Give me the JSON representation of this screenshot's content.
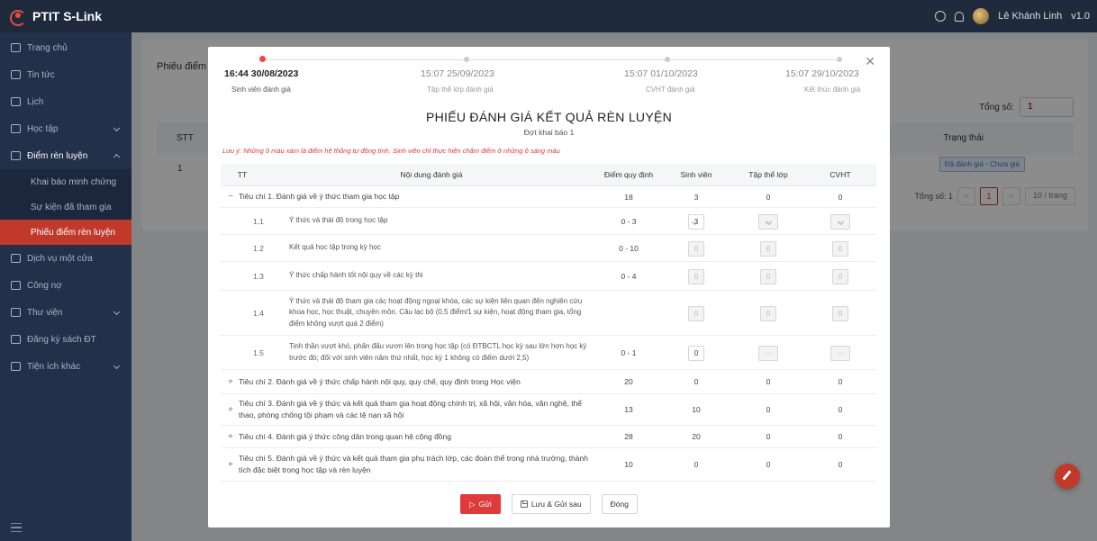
{
  "app": {
    "name": "PTIT S-Link",
    "user": "Lê Khánh Linh",
    "version": "v1.0"
  },
  "sidebar": {
    "items": [
      {
        "label": "Trang chủ"
      },
      {
        "label": "Tin tức"
      },
      {
        "label": "Lịch"
      },
      {
        "label": "Học tập"
      },
      {
        "label": "Điểm rèn luyện"
      },
      {
        "label": "Dịch vụ một cửa"
      },
      {
        "label": "Công nợ"
      },
      {
        "label": "Thư viện"
      },
      {
        "label": "Đăng ký sách ĐT"
      },
      {
        "label": "Tiện ích khác"
      }
    ],
    "sub_items": [
      {
        "label": "Khai báo minh chứng"
      },
      {
        "label": "Sự kiện đã tham gia"
      },
      {
        "label": "Phiếu điểm rèn luyện"
      }
    ]
  },
  "background": {
    "tab": "Phiếu điểm r",
    "total_label": "Tổng số:",
    "total_value": "1",
    "col_stt": "STT",
    "col_status": "Trạng thái",
    "row_stt": "1",
    "status_badge": "Đã đánh giá - Chưa giá",
    "pager_total": "Tổng số: 1",
    "pager_current": "1",
    "pager_size": "10 / trang"
  },
  "modal": {
    "steps": [
      {
        "time": "16:44 30/08/2023",
        "label": "Sinh viên đánh giá"
      },
      {
        "time": "15:07 25/09/2023",
        "label": "Tập thể lớp đánh giá"
      },
      {
        "time": "15:07 01/10/2023",
        "label": "CVHT đánh giá"
      },
      {
        "time": "15:07 29/10/2023",
        "label": "Kết thúc đánh giá"
      }
    ],
    "title": "PHIẾU ĐÁNH GIÁ KẾT QUẢ RÈN LUYỆN",
    "subtitle": "Đợt khai báo 1",
    "note": "Lưu ý: Những ô màu xám là điểm hệ thống tự động tính. Sinh viên chỉ thực hiện chấm điểm ở những ô sáng màu",
    "columns": {
      "tt": "TT",
      "content": "Nội dung đánh giá",
      "max": "Điểm quy định",
      "student": "Sinh viên",
      "class": "Tập thể lớp",
      "advisor": "CVHT"
    },
    "criterion1": {
      "toggle": "−",
      "label": "Tiêu chí 1. Đánh giá về ý thức tham gia học tập",
      "max": "18",
      "student": "3",
      "class": "0",
      "advisor": "0"
    },
    "sub_rows": [
      {
        "tt": "1.1",
        "label": "Ý thức và thái độ trong học tập",
        "max": "0 - 3",
        "student": "3",
        "class": "---",
        "advisor": "---"
      },
      {
        "tt": "1.2",
        "label": "Kết quả học tập trong kỳ học",
        "max": "0 - 10",
        "student": "0",
        "class": "0",
        "advisor": "0"
      },
      {
        "tt": "1.3",
        "label": "Ý thức chấp hành tốt nội quy về các kỳ thi",
        "max": "0 - 4",
        "student": "0",
        "class": "0",
        "advisor": "0"
      },
      {
        "tt": "1.4",
        "label": "Ý thức và thái độ tham gia các hoạt động ngoại khóa, các sự kiện liên quan đến nghiên cứu khoa học, học thuật, chuyên môn. Câu lạc bộ (0,5 điểm/1 sự kiện, hoạt động tham gia, tổng điểm không vượt quá 2 điểm)",
        "max": "",
        "student": "0",
        "class": "0",
        "advisor": "0"
      },
      {
        "tt": "1.5",
        "label": "Tinh thần vượt khó, phấn đấu vươn lên trong học tập (có ĐTBCTL học kỳ sau lớn hơn học kỳ trước đó; đối với sinh viên năm thứ nhất, học kỳ 1 không có điểm dưới 2,5)",
        "max": "0 - 1",
        "student": "0",
        "class": "---",
        "advisor": "---"
      }
    ],
    "criteria": [
      {
        "toggle": "+",
        "label": "Tiêu chí 2. Đánh giá về ý thức chấp hành nội quy, quy chế, quy định trong Học viện",
        "max": "20",
        "student": "0",
        "class": "0",
        "advisor": "0"
      },
      {
        "toggle": "+",
        "label": "Tiêu chí 3. Đánh giá về ý thức và kết quả tham gia hoạt động chính trị, xã hội, văn hóa, văn nghệ, thể thao, phòng chống tội phạm và các tệ nạn xã hội",
        "max": "13",
        "student": "10",
        "class": "0",
        "advisor": "0"
      },
      {
        "toggle": "+",
        "label": "Tiêu chí 4. Đánh giá ý thức công dân trong quan hệ cộng đồng",
        "max": "28",
        "student": "20",
        "class": "0",
        "advisor": "0"
      },
      {
        "toggle": "+",
        "label": "Tiêu chí 5. Đánh giá về ý thức và kết quả tham gia phụ trách lớp, các đoàn thể trong nhà trường, thành tích đặc biệt trong học tập và rèn luyện",
        "max": "10",
        "student": "0",
        "class": "0",
        "advisor": "0"
      }
    ],
    "buttons": {
      "send": "Gửi",
      "save_later": "Lưu & Gửi sau",
      "close": "Đóng"
    }
  },
  "colors": {
    "accent": "#e03b3b",
    "sidebar": "#23304a",
    "topbar": "#1f2a3c"
  },
  "icons": [
    "home-icon",
    "news-icon",
    "calendar-icon",
    "study-icon",
    "user-icon",
    "document-icon",
    "money-icon",
    "library-icon",
    "book-icon",
    "grid-icon",
    "info-icon",
    "bell-icon",
    "close-icon",
    "send-icon",
    "save-icon",
    "edit-icon",
    "menu-collapse-icon"
  ]
}
